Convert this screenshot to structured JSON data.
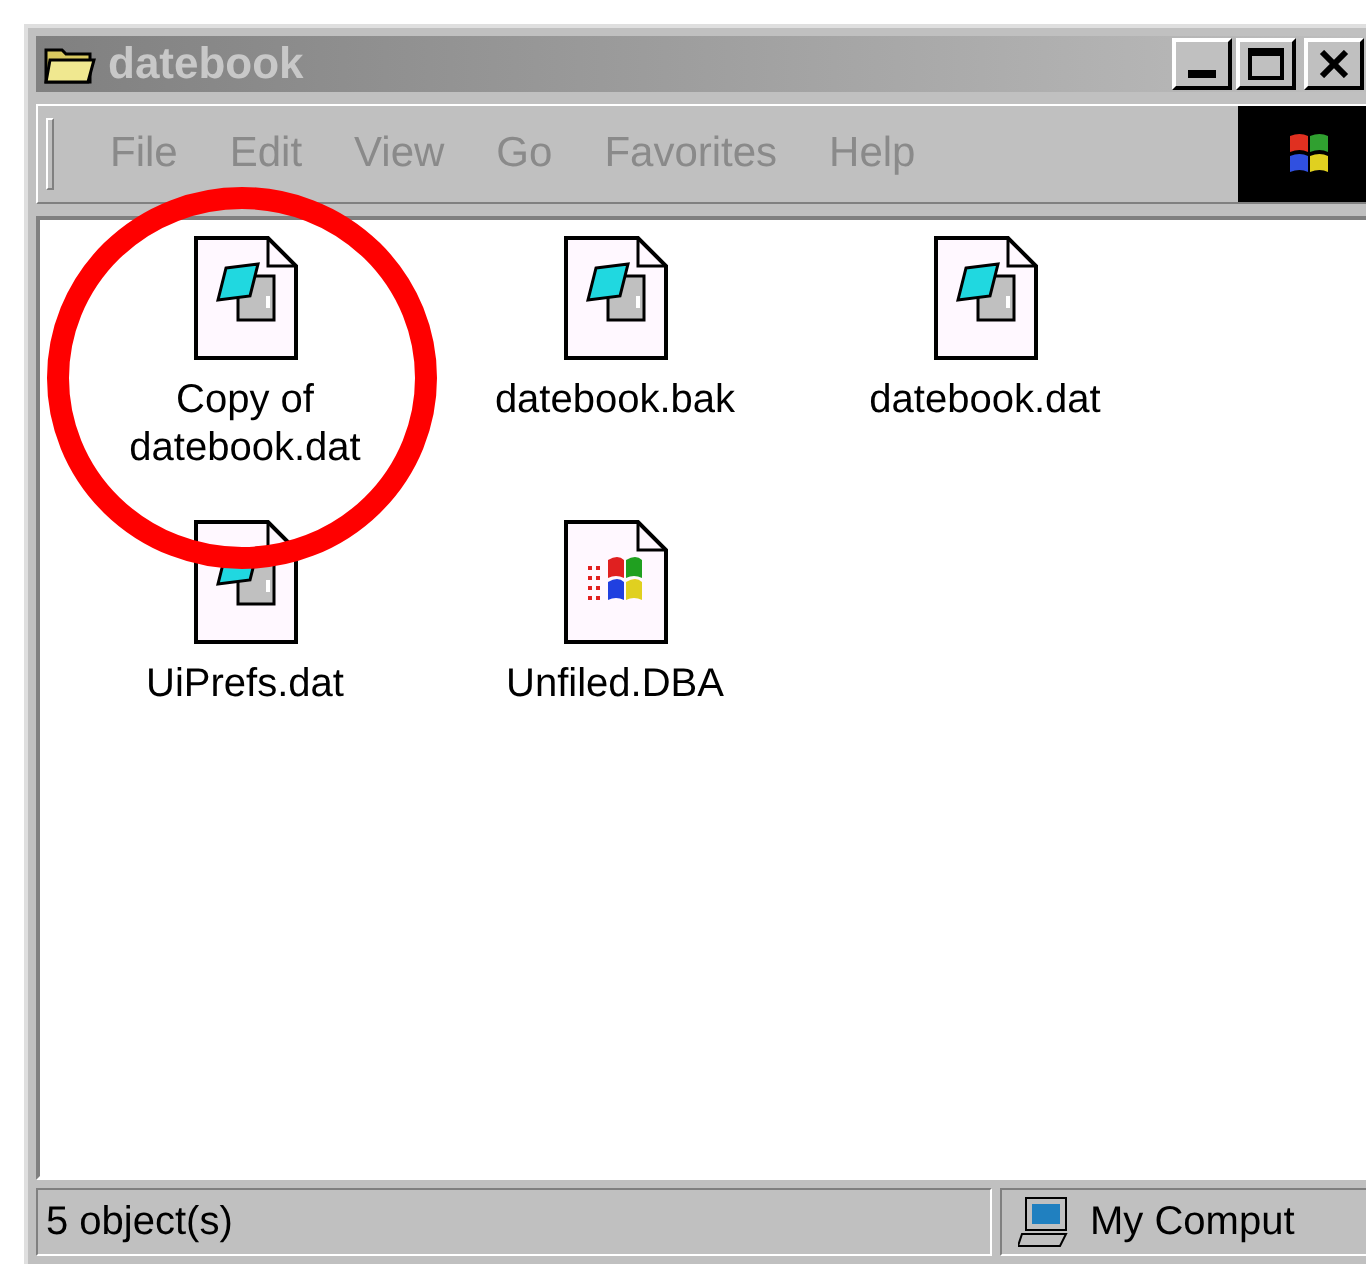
{
  "window": {
    "title": "datebook",
    "active": false
  },
  "menu": [
    {
      "label": "File"
    },
    {
      "label": "Edit"
    },
    {
      "label": "View"
    },
    {
      "label": "Go"
    },
    {
      "label": "Favorites"
    },
    {
      "label": "Help"
    }
  ],
  "files": [
    {
      "name": "Copy of datebook.dat",
      "kind": "datebook"
    },
    {
      "name": "datebook.bak",
      "kind": "datebook"
    },
    {
      "name": "datebook.dat",
      "kind": "datebook"
    },
    {
      "name": "UiPrefs.dat",
      "kind": "datebook"
    },
    {
      "name": "Unfiled.DBA",
      "kind": "windows"
    }
  ],
  "status_bar": {
    "count": "5 object(s)",
    "zone": "My Comput"
  }
}
